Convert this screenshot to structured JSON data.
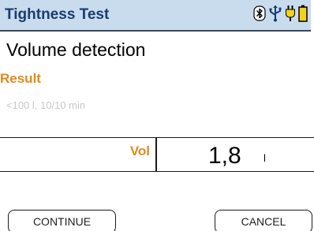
{
  "header": {
    "title": "Tightness Test",
    "icons": [
      "bluetooth-icon",
      "usb-icon",
      "plug-icon",
      "battery-icon"
    ]
  },
  "main": {
    "heading": "Volume detection",
    "result_label": "Result",
    "result_detail": "<100 l, 10/10 min",
    "measurement": {
      "label": "Vol",
      "value": "1,8",
      "unit": "l"
    }
  },
  "softkeys": {
    "left_label": "CONTINUE",
    "right_label": "CANCEL"
  },
  "colors": {
    "title_bar": "#c9dcee",
    "title_text": "#1a3c6e",
    "accent": "#e08a1e",
    "disabled_text": "#c8c8c8"
  }
}
